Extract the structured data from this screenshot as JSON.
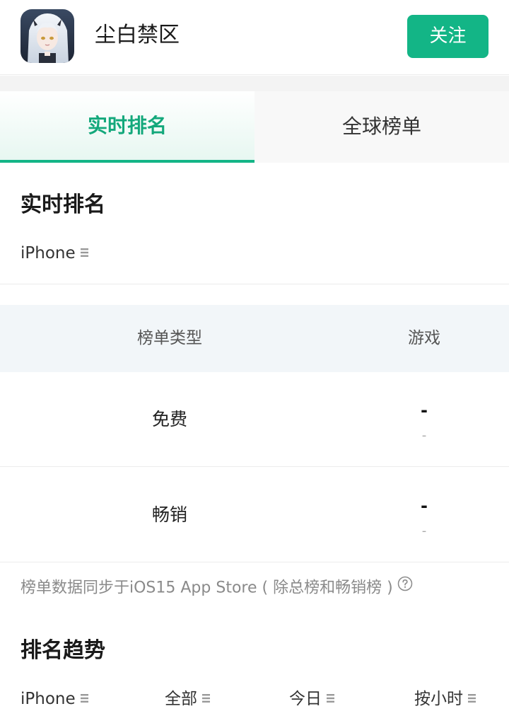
{
  "app": {
    "name": "尘白禁区",
    "icon": "game-character-avatar"
  },
  "header": {
    "follow_label": "关注",
    "accent_color": "#13b586"
  },
  "tabs": [
    {
      "label": "实时排名",
      "active": true
    },
    {
      "label": "全球榜单",
      "active": false
    }
  ],
  "realtime": {
    "title": "实时排名",
    "device_filter": "iPhone",
    "table": {
      "headers": [
        "榜单类型",
        "游戏"
      ],
      "rows": [
        {
          "type": "免费",
          "rank": "-",
          "change": "-"
        },
        {
          "type": "畅销",
          "rank": "-",
          "change": "-"
        }
      ]
    },
    "note": "榜单数据同步于iOS15 App Store ( 除总榜和畅销榜 )"
  },
  "trend": {
    "title": "排名趋势",
    "filters": [
      "iPhone",
      "全部",
      "今日",
      "按小时"
    ]
  }
}
